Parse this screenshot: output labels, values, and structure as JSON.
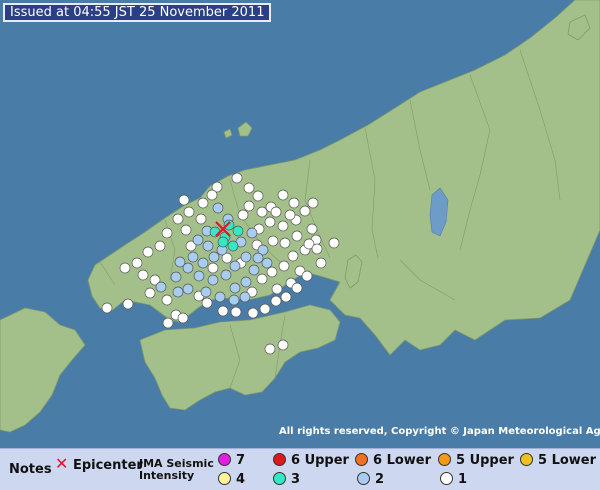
{
  "header": {
    "issued": "Issued at 04:55 JST  25 November 2011"
  },
  "map": {
    "sea_color": "#4a7ca8",
    "land_color": "#a4c08a",
    "lake_color": "#6e9cc8",
    "epicenter_icon": "red-x-icon",
    "copyright": "All rights reserved, Copyright © Japan Meteorological Agency",
    "stations": {
      "intensity_3": [
        [
          215,
          232
        ],
        [
          225,
          237
        ],
        [
          233,
          246
        ],
        [
          238,
          231
        ],
        [
          223,
          242
        ],
        [
          229,
          225
        ]
      ],
      "intensity_2": [
        [
          198,
          240
        ],
        [
          208,
          246
        ],
        [
          193,
          257
        ],
        [
          180,
          262
        ],
        [
          176,
          277
        ],
        [
          188,
          268
        ],
        [
          203,
          263
        ],
        [
          214,
          257
        ],
        [
          222,
          250
        ],
        [
          241,
          242
        ],
        [
          252,
          233
        ],
        [
          246,
          257
        ],
        [
          235,
          266
        ],
        [
          226,
          275
        ],
        [
          213,
          280
        ],
        [
          199,
          276
        ],
        [
          188,
          289
        ],
        [
          178,
          292
        ],
        [
          161,
          287
        ],
        [
          206,
          292
        ],
        [
          220,
          297
        ],
        [
          235,
          288
        ],
        [
          246,
          282
        ],
        [
          254,
          270
        ],
        [
          263,
          250
        ],
        [
          218,
          208
        ],
        [
          228,
          219
        ],
        [
          207,
          231
        ],
        [
          258,
          258
        ],
        [
          267,
          263
        ],
        [
          245,
          297
        ],
        [
          234,
          300
        ]
      ],
      "intensity_1": [
        [
          217,
          187
        ],
        [
          212,
          195
        ],
        [
          203,
          203
        ],
        [
          237,
          178
        ],
        [
          249,
          188
        ],
        [
          258,
          196
        ],
        [
          271,
          207
        ],
        [
          262,
          212
        ],
        [
          249,
          206
        ],
        [
          243,
          215
        ],
        [
          283,
          195
        ],
        [
          294,
          203
        ],
        [
          305,
          211
        ],
        [
          313,
          203
        ],
        [
          296,
          220
        ],
        [
          283,
          226
        ],
        [
          270,
          222
        ],
        [
          312,
          229
        ],
        [
          297,
          236
        ],
        [
          285,
          243
        ],
        [
          273,
          241
        ],
        [
          257,
          245
        ],
        [
          305,
          250
        ],
        [
          293,
          256
        ],
        [
          284,
          266
        ],
        [
          272,
          272
        ],
        [
          262,
          279
        ],
        [
          252,
          292
        ],
        [
          277,
          289
        ],
        [
          291,
          283
        ],
        [
          300,
          271
        ],
        [
          316,
          240
        ],
        [
          334,
          243
        ],
        [
          321,
          263
        ],
        [
          307,
          276
        ],
        [
          297,
          288
        ],
        [
          286,
          297
        ],
        [
          276,
          301
        ],
        [
          265,
          309
        ],
        [
          253,
          313
        ],
        [
          184,
          200
        ],
        [
          189,
          212
        ],
        [
          178,
          219
        ],
        [
          186,
          230
        ],
        [
          167,
          233
        ],
        [
          160,
          246
        ],
        [
          148,
          252
        ],
        [
          137,
          263
        ],
        [
          125,
          268
        ],
        [
          143,
          275
        ],
        [
          155,
          280
        ],
        [
          150,
          293
        ],
        [
          167,
          300
        ],
        [
          176,
          315
        ],
        [
          183,
          318
        ],
        [
          168,
          323
        ],
        [
          107,
          308
        ],
        [
          128,
          304
        ],
        [
          270,
          349
        ],
        [
          283,
          345
        ],
        [
          207,
          303
        ],
        [
          199,
          296
        ],
        [
          223,
          311
        ],
        [
          236,
          312
        ],
        [
          241,
          263
        ],
        [
          227,
          258
        ],
        [
          213,
          268
        ],
        [
          259,
          229
        ],
        [
          276,
          212
        ],
        [
          290,
          215
        ],
        [
          309,
          244
        ],
        [
          317,
          249
        ],
        [
          201,
          219
        ],
        [
          191,
          246
        ]
      ]
    }
  },
  "legend": {
    "notes": "Notes",
    "epicenter": "Epicenter",
    "jma_line1": "JMA Seismic",
    "jma_line2": "Intensity",
    "items": [
      {
        "label": "7",
        "color": "#e020e0"
      },
      {
        "label": "6 Upper",
        "color": "#e01818"
      },
      {
        "label": "6 Lower",
        "color": "#f07020"
      },
      {
        "label": "5 Upper",
        "color": "#f09a18"
      },
      {
        "label": "5 Lower",
        "color": "#f0c020"
      },
      {
        "label": "4",
        "color": "#fff29a"
      },
      {
        "label": "3",
        "color": "#35e8c4"
      },
      {
        "label": "2",
        "color": "#a9cdf0"
      },
      {
        "label": "1",
        "color": "#ffffff"
      }
    ]
  }
}
